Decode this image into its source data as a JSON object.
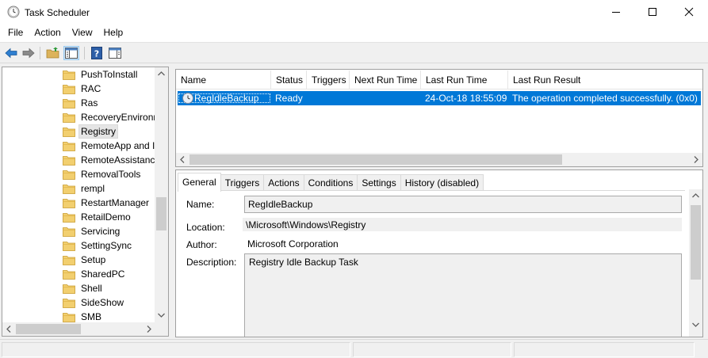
{
  "window": {
    "title": "Task Scheduler",
    "icon": "clock-icon"
  },
  "menu": {
    "items": [
      "File",
      "Action",
      "View",
      "Help"
    ]
  },
  "toolbar": {
    "buttons": [
      "back-arrow-icon",
      "forward-arrow-icon",
      "up-folder-icon",
      "show-hide-tree-icon",
      "help-icon",
      "show-hide-action-pane-icon"
    ]
  },
  "tree": {
    "items": [
      {
        "label": "PushToInstall"
      },
      {
        "label": "RAC"
      },
      {
        "label": "Ras"
      },
      {
        "label": "RecoveryEnvironn"
      },
      {
        "label": "Registry",
        "selected": true
      },
      {
        "label": "RemoteApp and I"
      },
      {
        "label": "RemoteAssistanc"
      },
      {
        "label": "RemovalTools"
      },
      {
        "label": "rempl"
      },
      {
        "label": "RestartManager"
      },
      {
        "label": "RetailDemo"
      },
      {
        "label": "Servicing"
      },
      {
        "label": "SettingSync"
      },
      {
        "label": "Setup"
      },
      {
        "label": "SharedPC"
      },
      {
        "label": "Shell"
      },
      {
        "label": "SideShow"
      },
      {
        "label": "SMB"
      }
    ]
  },
  "task_list": {
    "columns": [
      "Name",
      "Status",
      "Triggers",
      "Next Run Time",
      "Last Run Time",
      "Last Run Result"
    ],
    "rows": [
      {
        "name": "RegIdleBackup",
        "status": "Ready",
        "triggers": "",
        "next_run_time": "",
        "last_run_time": "24-Oct-18 18:55:09",
        "last_run_result": "The operation completed successfully. (0x0)"
      }
    ]
  },
  "details": {
    "tabs": [
      "General",
      "Triggers",
      "Actions",
      "Conditions",
      "Settings",
      "History (disabled)"
    ],
    "active_tab": "General",
    "fields": {
      "name_label": "Name:",
      "name_value": "RegIdleBackup",
      "location_label": "Location:",
      "location_value": "\\Microsoft\\Windows\\Registry",
      "author_label": "Author:",
      "author_value": "Microsoft Corporation",
      "description_label": "Description:",
      "description_value": "Registry Idle Backup Task"
    }
  },
  "colors": {
    "selection": "#0078d7",
    "folder": "#dcb35c"
  }
}
